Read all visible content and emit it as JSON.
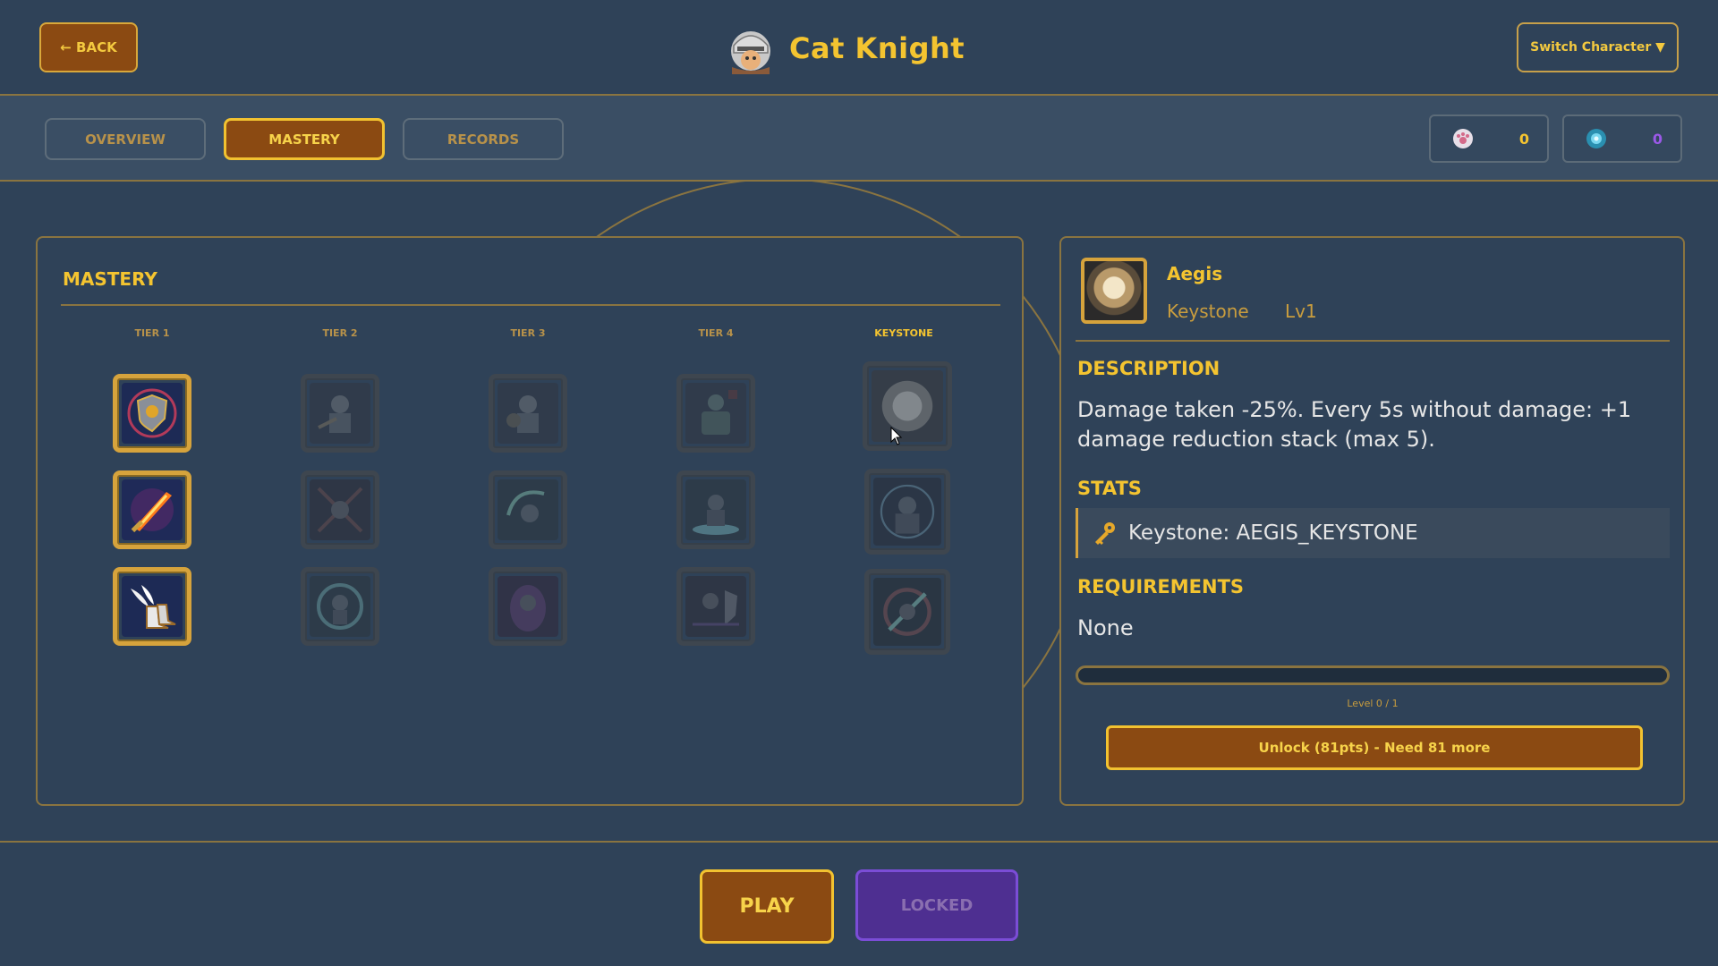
{
  "header": {
    "back_label": "← BACK",
    "title": "Cat Knight",
    "switch_label": "Switch Character ▼"
  },
  "tabs": [
    {
      "label": "OVERVIEW",
      "active": false
    },
    {
      "label": "MASTERY",
      "active": true
    },
    {
      "label": "RECORDS",
      "active": false
    }
  ],
  "currencies": [
    {
      "icon": "paw-orb-icon",
      "value": "0",
      "color": "#f4c430"
    },
    {
      "icon": "crystal-orb-icon",
      "value": "0",
      "color": "#9b59e8"
    }
  ],
  "mastery": {
    "title": "MASTERY",
    "tiers": [
      "TIER 1",
      "TIER 2",
      "TIER 3",
      "TIER 4",
      "KEYSTONE"
    ],
    "nodes": [
      [
        {
          "name": "shield-crest",
          "unlocked": true
        },
        {
          "name": "flame-sword",
          "unlocked": true
        },
        {
          "name": "winged-boots",
          "unlocked": true
        }
      ],
      [
        {
          "name": "armored-knight",
          "unlocked": false
        },
        {
          "name": "crossed-blades-knight",
          "unlocked": false
        },
        {
          "name": "teal-aura-knight",
          "unlocked": false
        }
      ],
      [
        {
          "name": "guard-knight",
          "unlocked": false
        },
        {
          "name": "spin-slash-knight",
          "unlocked": false
        },
        {
          "name": "purple-aura-knight",
          "unlocked": false
        }
      ],
      [
        {
          "name": "green-golem",
          "unlocked": false
        },
        {
          "name": "water-knight",
          "unlocked": false
        },
        {
          "name": "shield-bash-knight",
          "unlocked": false
        }
      ],
      [
        {
          "name": "aegis",
          "unlocked": false
        },
        {
          "name": "runic-knight",
          "unlocked": false
        },
        {
          "name": "vortex-blade",
          "unlocked": false
        }
      ]
    ]
  },
  "detail": {
    "name": "Aegis",
    "type": "Keystone",
    "level": "Lv1",
    "description_title": "DESCRIPTION",
    "description": "Damage taken -25%. Every 5s without damage: +1 damage reduction stack (max 5).",
    "stats_title": "STATS",
    "stat_icon": "key-icon",
    "stat": "Keystone: AEGIS_KEYSTONE",
    "requirements_title": "REQUIREMENTS",
    "requirements": "None",
    "progress_fraction": 0,
    "progress_label": "Level 0 / 1",
    "unlock_label": "Unlock (81pts) - Need 81 more"
  },
  "footer": {
    "play_label": "PLAY",
    "locked_label": "LOCKED"
  }
}
